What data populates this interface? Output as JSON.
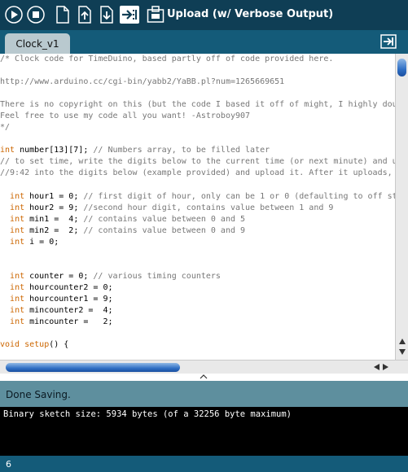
{
  "toolbar": {
    "buttons": [
      {
        "name": "verify-icon",
        "title": "Verify"
      },
      {
        "name": "stop-icon",
        "title": "Stop"
      },
      {
        "name": "new-icon",
        "title": "New"
      },
      {
        "name": "open-icon",
        "title": "Open"
      },
      {
        "name": "save-icon",
        "title": "Save"
      },
      {
        "name": "upload-icon",
        "title": "Upload"
      },
      {
        "name": "serial-monitor-icon",
        "title": "Serial Monitor"
      }
    ],
    "status_label": "Upload (w/ Verbose Output)"
  },
  "tabs": [
    {
      "label": "Clock_v1",
      "active": true
    }
  ],
  "editor": {
    "lines": [
      [
        {
          "t": "/* Clock code for TimeDuino, based partly off of code provided here.",
          "c": "com"
        }
      ],
      [
        {
          "t": "",
          "c": "com"
        }
      ],
      [
        {
          "t": "http://www.arduino.cc/cgi-bin/yabb2/YaBB.pl?num=1265669651",
          "c": "com"
        }
      ],
      [
        {
          "t": "",
          "c": "com"
        }
      ],
      [
        {
          "t": "There is no copyright on this (but the code I based it off of might, I highly dou",
          "c": "com"
        }
      ],
      [
        {
          "t": "Feel free to use my code all you want! -Astroboy907",
          "c": "com"
        }
      ],
      [
        {
          "t": "*/",
          "c": "com"
        }
      ],
      [
        {
          "t": "",
          "c": "plain"
        }
      ],
      [
        {
          "t": "int",
          "c": "kw"
        },
        {
          "t": " number[13][7]; ",
          "c": "plain"
        },
        {
          "t": "// Numbers array, to be filled later",
          "c": "com"
        }
      ],
      [
        {
          "t": "// to set time, write the digits below to the current time (or next minute) and u",
          "c": "com"
        }
      ],
      [
        {
          "t": "//9:42 into the digits below (example provided) and upload it. After it uploads,",
          "c": "com"
        }
      ],
      [
        {
          "t": "",
          "c": "plain"
        }
      ],
      [
        {
          "t": "  ",
          "c": "plain"
        },
        {
          "t": "int",
          "c": "kw"
        },
        {
          "t": " hour1 = 0; ",
          "c": "plain"
        },
        {
          "t": "// first digit of hour, only can be 1 or 0 (defaulting to off st",
          "c": "com"
        }
      ],
      [
        {
          "t": "  ",
          "c": "plain"
        },
        {
          "t": "int",
          "c": "kw"
        },
        {
          "t": " hour2 = 9; ",
          "c": "plain"
        },
        {
          "t": "//second hour digit, contains value between 1 and 9",
          "c": "com"
        }
      ],
      [
        {
          "t": "  ",
          "c": "plain"
        },
        {
          "t": "int",
          "c": "kw"
        },
        {
          "t": " min1 =  4; ",
          "c": "plain"
        },
        {
          "t": "// contains value between 0 and 5",
          "c": "com"
        }
      ],
      [
        {
          "t": "  ",
          "c": "plain"
        },
        {
          "t": "int",
          "c": "kw"
        },
        {
          "t": " min2 =  2; ",
          "c": "plain"
        },
        {
          "t": "// contains value between 0 and 9",
          "c": "com"
        }
      ],
      [
        {
          "t": "  ",
          "c": "plain"
        },
        {
          "t": "int",
          "c": "kw"
        },
        {
          "t": " i = 0;",
          "c": "plain"
        }
      ],
      [
        {
          "t": "",
          "c": "plain"
        }
      ],
      [
        {
          "t": "",
          "c": "plain"
        }
      ],
      [
        {
          "t": "  ",
          "c": "plain"
        },
        {
          "t": "int",
          "c": "kw"
        },
        {
          "t": " counter = 0; ",
          "c": "plain"
        },
        {
          "t": "// various timing counters",
          "c": "com"
        }
      ],
      [
        {
          "t": "  ",
          "c": "plain"
        },
        {
          "t": "int",
          "c": "kw"
        },
        {
          "t": " hourcounter2 = 0;",
          "c": "plain"
        }
      ],
      [
        {
          "t": "  ",
          "c": "plain"
        },
        {
          "t": "int",
          "c": "kw"
        },
        {
          "t": " hourcounter1 = 9;",
          "c": "plain"
        }
      ],
      [
        {
          "t": "  ",
          "c": "plain"
        },
        {
          "t": "int",
          "c": "kw"
        },
        {
          "t": " mincounter2 =  4;",
          "c": "plain"
        }
      ],
      [
        {
          "t": "  ",
          "c": "plain"
        },
        {
          "t": "int",
          "c": "kw"
        },
        {
          "t": " mincounter =   2;",
          "c": "plain"
        }
      ],
      [
        {
          "t": "",
          "c": "plain"
        }
      ],
      [
        {
          "t": "void",
          "c": "kw"
        },
        {
          "t": " ",
          "c": "plain"
        },
        {
          "t": "setup",
          "c": "kw"
        },
        {
          "t": "() {",
          "c": "plain"
        }
      ]
    ]
  },
  "status": {
    "message": "Done Saving."
  },
  "console": {
    "text": "Binary sketch size: 5934 bytes (of a 32256 byte maximum)"
  },
  "footer": {
    "line_number": "6"
  },
  "colors": {
    "toolbar_bg": "#0f3e55",
    "tabbar_bg": "#145b79",
    "status_bg": "#5e8f9e",
    "comment": "#777777",
    "keyword": "#cc6600",
    "console_bg": "#000000"
  }
}
